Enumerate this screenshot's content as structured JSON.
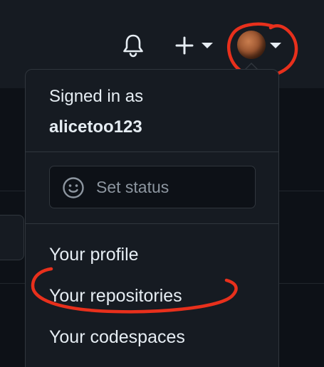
{
  "header": {
    "notifications_icon": "bell-icon",
    "create_icon": "plus-icon",
    "create_caret_icon": "caret-down-icon",
    "avatar_caret_icon": "caret-down-icon"
  },
  "menu": {
    "signed_in_label": "Signed in as",
    "username": "alicetoo123",
    "status": {
      "icon": "smiley-icon",
      "label": "Set status"
    },
    "items": [
      {
        "label": "Your profile"
      },
      {
        "label": "Your repositories"
      },
      {
        "label": "Your codespaces"
      }
    ]
  },
  "colors": {
    "background": "#0d1117",
    "header": "#161b22",
    "menu_bg": "#161b22",
    "border": "#30363d",
    "text": "#e6edf3",
    "muted_text": "#8d96a0",
    "annotation": "#e8301c"
  }
}
